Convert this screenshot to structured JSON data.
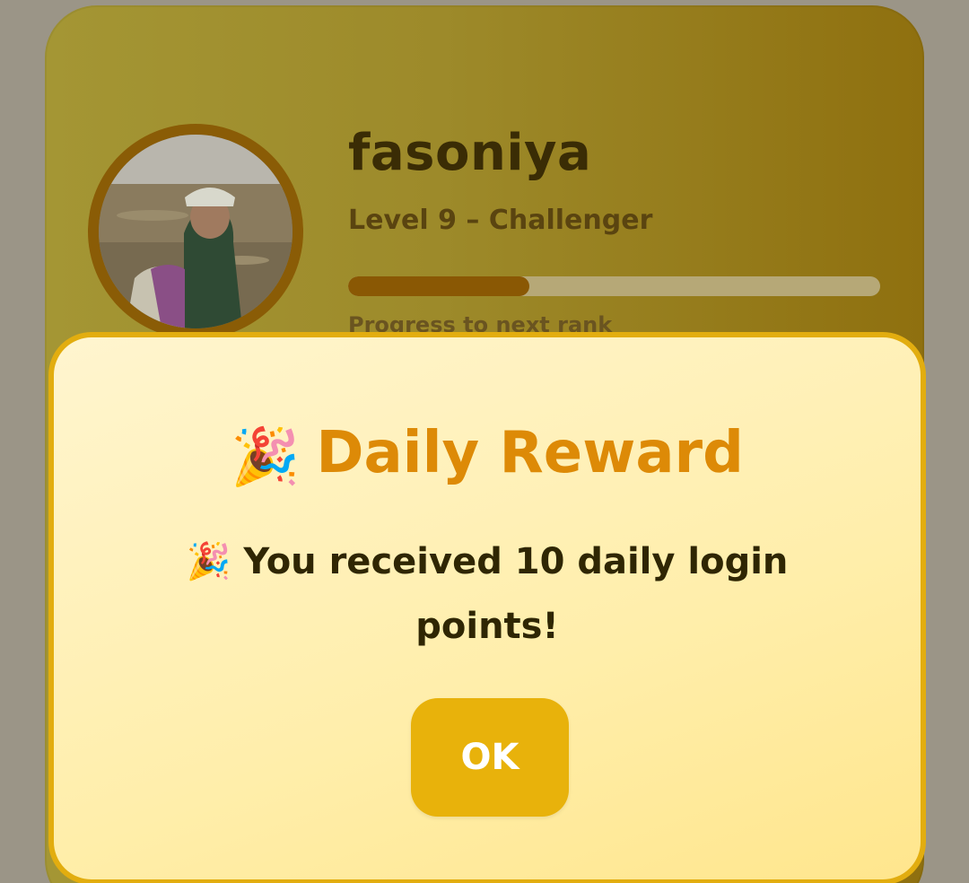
{
  "profile": {
    "username": "fasoniya",
    "level_text": "Level 9 – Challenger",
    "progress_label": "Progress to next rank",
    "progress_fraction": 0.34,
    "avatar_icon": "user-photo"
  },
  "dialog": {
    "title_emoji": "🎉",
    "title": "Daily Reward",
    "message_emoji": "🎉",
    "message": "You received 10 daily login points!",
    "ok_label": "OK"
  },
  "colors": {
    "accent": "#e8b20b",
    "title": "#dd8a07",
    "progress_fill": "#8a5804"
  }
}
